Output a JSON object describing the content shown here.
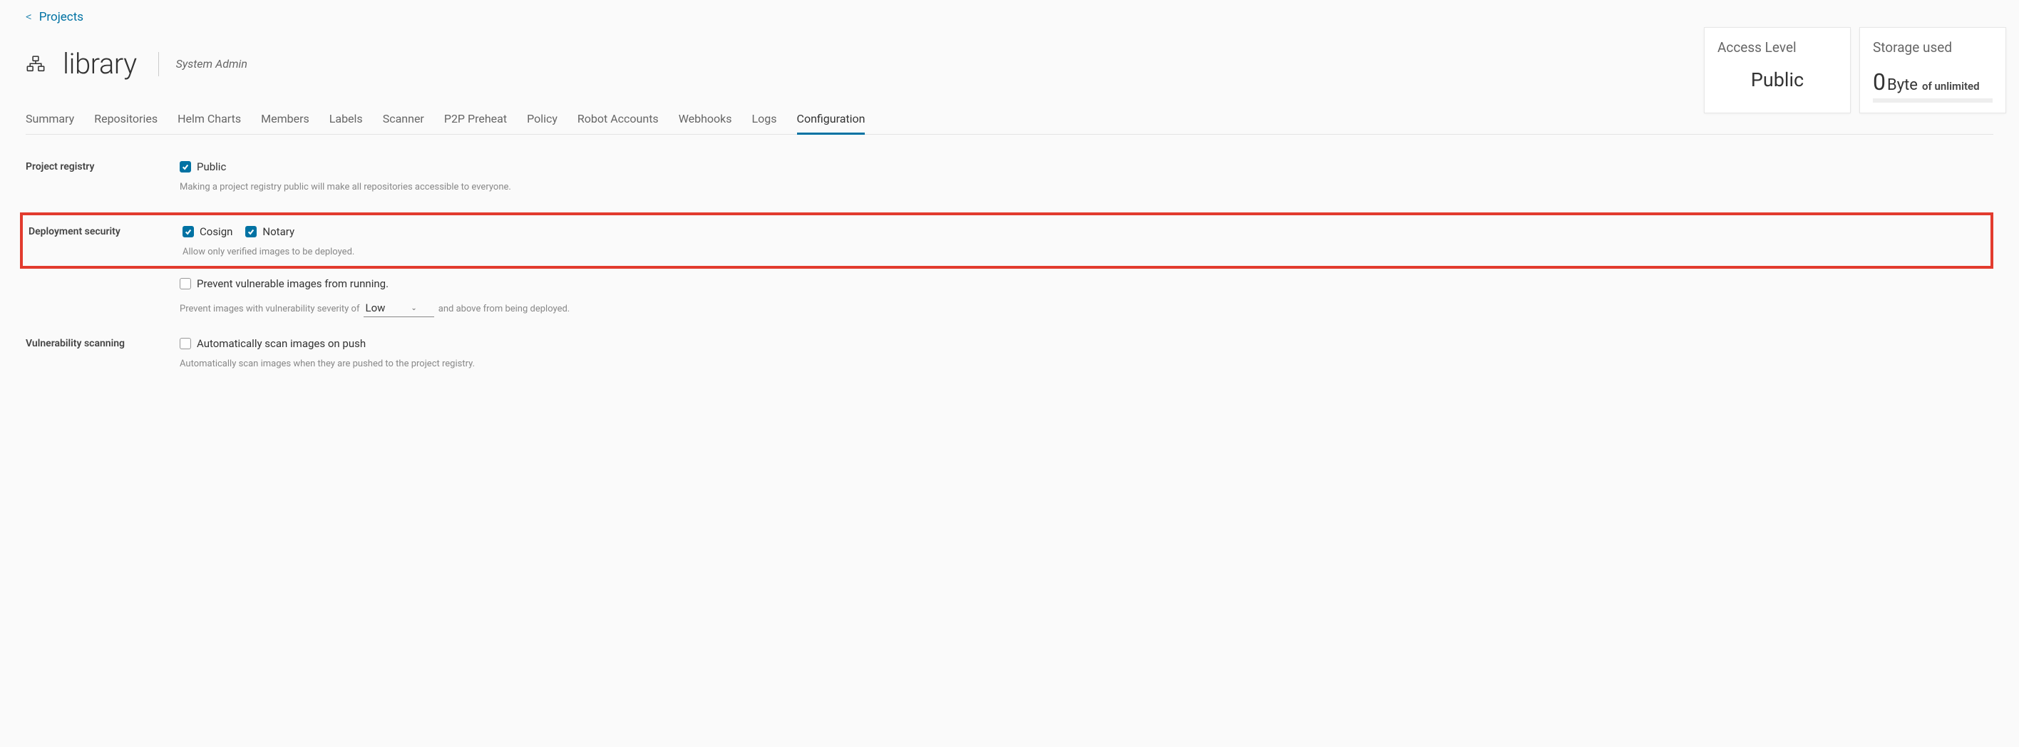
{
  "breadcrumb": {
    "label": "Projects"
  },
  "project": {
    "name": "library",
    "role": "System Admin"
  },
  "cards": {
    "access": {
      "title": "Access Level",
      "value": "Public"
    },
    "storage": {
      "title": "Storage used",
      "value": "0",
      "unit": "Byte",
      "suffix": "of unlimited"
    }
  },
  "tabs": [
    {
      "label": "Summary"
    },
    {
      "label": "Repositories"
    },
    {
      "label": "Helm Charts"
    },
    {
      "label": "Members"
    },
    {
      "label": "Labels"
    },
    {
      "label": "Scanner"
    },
    {
      "label": "P2P Preheat"
    },
    {
      "label": "Policy"
    },
    {
      "label": "Robot Accounts"
    },
    {
      "label": "Webhooks"
    },
    {
      "label": "Logs"
    },
    {
      "label": "Configuration",
      "active": true
    }
  ],
  "config": {
    "registry": {
      "label": "Project registry",
      "public_label": "Public",
      "public_checked": true,
      "help": "Making a project registry public will make all repositories accessible to everyone."
    },
    "deployment": {
      "label": "Deployment security",
      "cosign_label": "Cosign",
      "cosign_checked": true,
      "notary_label": "Notary",
      "notary_checked": true,
      "help": "Allow only verified images to be deployed.",
      "prevent_label": "Prevent vulnerable images from running.",
      "prevent_checked": false,
      "severity_prefix": "Prevent images with vulnerability severity of",
      "severity_value": "Low",
      "severity_suffix": "and above from being deployed."
    },
    "vuln": {
      "label": "Vulnerability scanning",
      "auto_label": "Automatically scan images on push",
      "auto_checked": false,
      "help": "Automatically scan images when they are pushed to the project registry."
    }
  }
}
